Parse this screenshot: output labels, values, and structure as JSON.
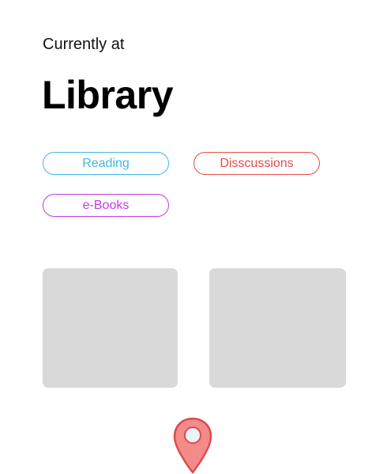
{
  "header": {
    "subtitle": "Currently at",
    "title": "Library"
  },
  "tags": [
    {
      "label": "Reading",
      "color": "#3fb8e8"
    },
    {
      "label": "Disscussions",
      "color": "#e84a4a"
    },
    {
      "label": "e-Books",
      "color": "#c53ae6"
    }
  ],
  "cards": {
    "placeholder_color": "#d9d9d9"
  },
  "location_pin": {
    "icon": "map-pin-icon",
    "fill_color": "#f48a8a",
    "stroke_color": "#d94d4d",
    "inner_color": "#eef2f8"
  }
}
